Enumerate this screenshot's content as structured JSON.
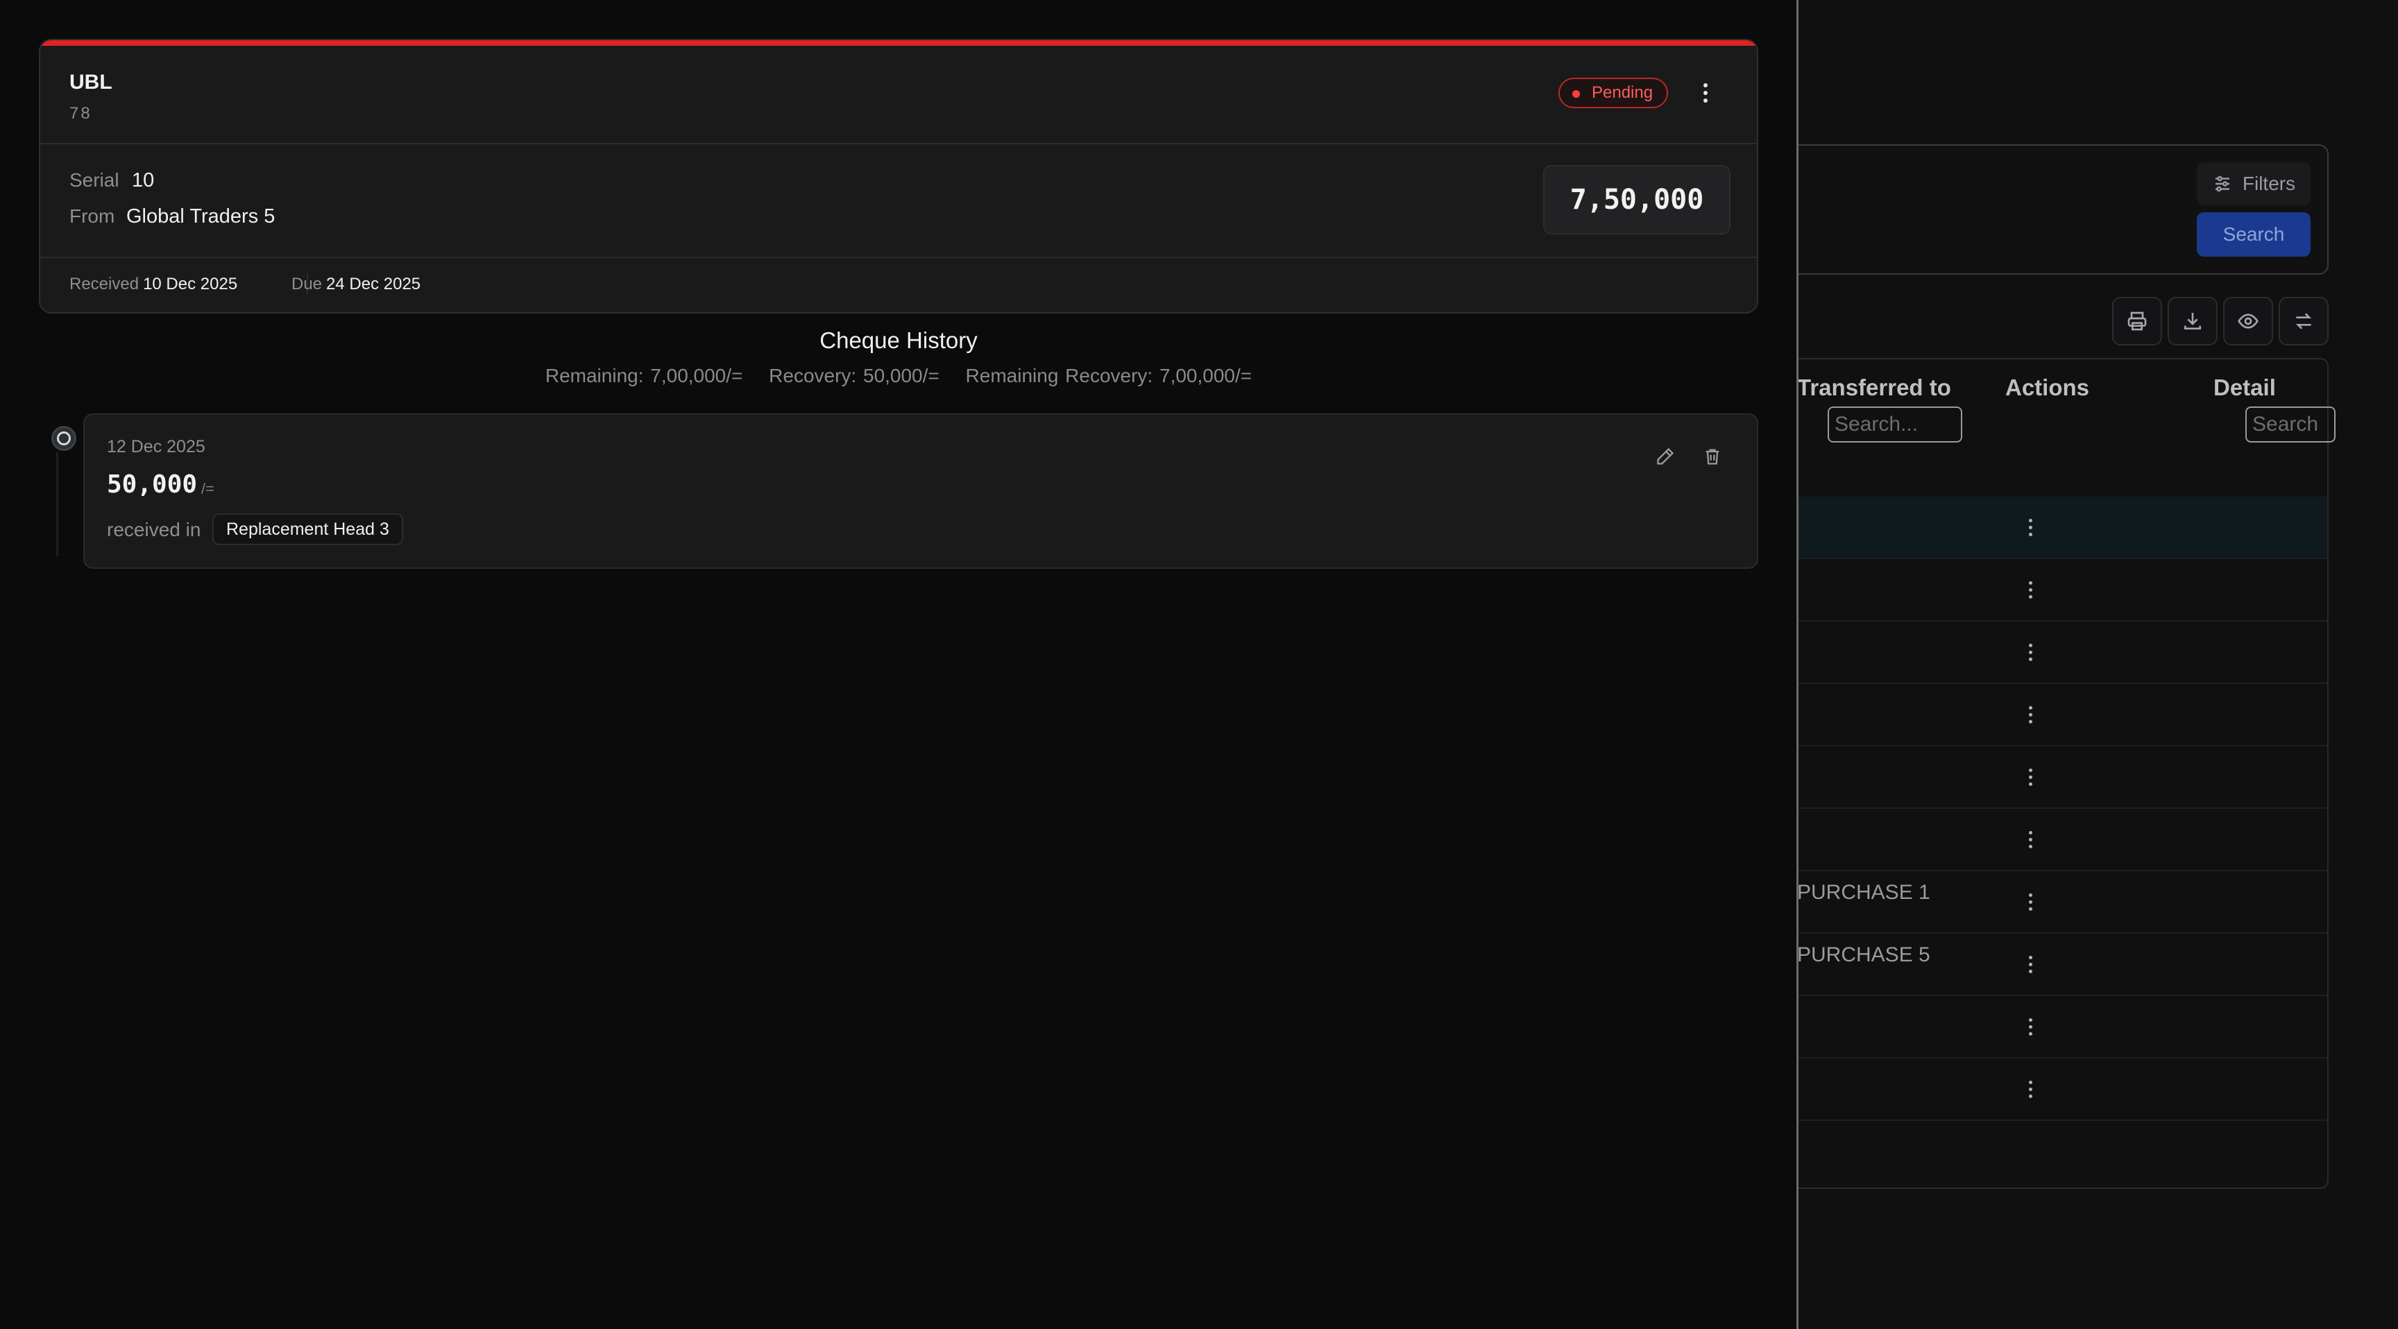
{
  "background": {
    "filters_label": "Filters",
    "search_label": "Search",
    "toolbar_icons": [
      "printer-icon",
      "download-icon",
      "eye-icon",
      "transfer-icon"
    ],
    "table": {
      "columns": [
        {
          "label": "Transferred to",
          "search_placeholder": "Search..."
        },
        {
          "label": "Actions"
        },
        {
          "label": "Detail",
          "search_placeholder": "Search"
        }
      ],
      "rows": [
        {
          "transferred_to": ""
        },
        {
          "transferred_to": ""
        },
        {
          "transferred_to": ""
        },
        {
          "transferred_to": ""
        },
        {
          "transferred_to": ""
        },
        {
          "transferred_to": ""
        },
        {
          "transferred_to": "PURCHASE 1"
        },
        {
          "transferred_to": "PURCHASE 5"
        },
        {
          "transferred_to": ""
        },
        {
          "transferred_to": ""
        }
      ]
    }
  },
  "cheque": {
    "bank": "UBL",
    "account": "78",
    "status": "Pending",
    "serial_label": "Serial",
    "serial": "10",
    "from_label": "From",
    "from": "Global Traders 5",
    "amount": "7,50,000",
    "received_label": "Received",
    "received_date": "10 Dec 2025",
    "due_label": "Due",
    "due_date": "24 Dec 2025",
    "accent_color": "#e02424"
  },
  "history": {
    "title": "Cheque History",
    "remaining": "Remaining: 7,00,000/=",
    "recovery": "Recovery: 50,000/=",
    "remaining_recovery": "Remaining Recovery: 7,00,000/=",
    "entries": [
      {
        "date": "12 Dec 2025",
        "amount": "50,000",
        "suffix": "/=",
        "received_in_label": "received in",
        "received_in": "Replacement Head 3"
      }
    ]
  }
}
